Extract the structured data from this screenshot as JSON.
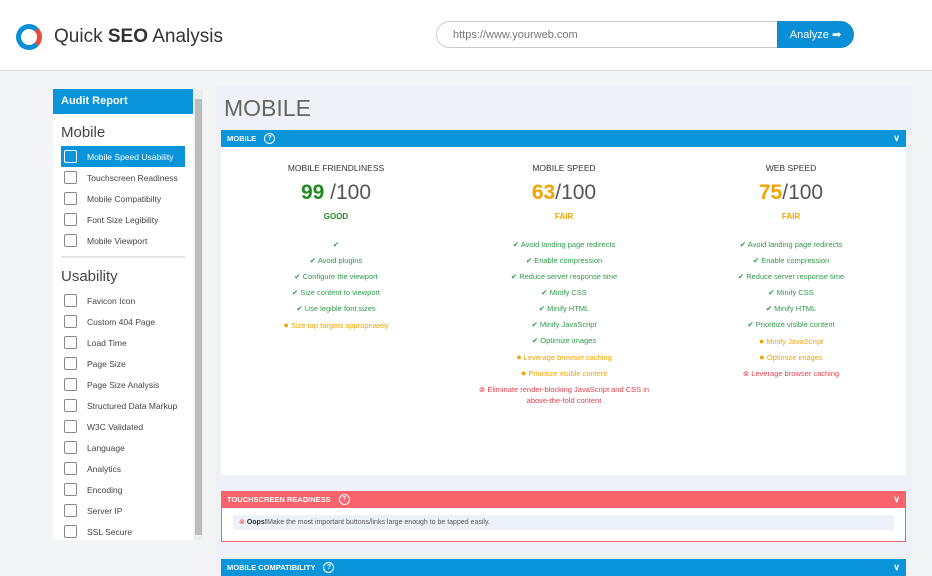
{
  "header": {
    "brand_prefix": "Quick",
    "brand_bold": "SEO",
    "brand_suffix": "Analysis",
    "search_placeholder": "https://www.yourweb.com",
    "analyze_label": "Analyze ➡"
  },
  "sidebar": {
    "title": "Audit Report",
    "sections": [
      {
        "title": "Mobile",
        "items": [
          "Mobile Speed Usability",
          "Touchscreen Readiness",
          "Mobile Compatibilty",
          "Font Size Legibility",
          "Mobile Viewport"
        ]
      },
      {
        "title": "Usability",
        "items": [
          "Favicon Icon",
          "Custom 404 Page",
          "Load Time",
          "Page Size",
          "Page Size Analysis",
          "Structured Data Markup",
          "W3C Validated",
          "Language",
          "Analytics",
          "Encoding",
          "Server IP",
          "SSL Secure"
        ]
      }
    ],
    "active": "Mobile Speed Usability"
  },
  "main": {
    "title": "MOBILE",
    "mobile_section": {
      "label": "MOBILE",
      "columns": [
        {
          "title": "MOBILE FRIENDLINESS",
          "score": "99",
          "max": " /100",
          "rating": "GOOD",
          "color": "#1f8a1f",
          "items": [
            {
              "s": "ok",
              "t": ""
            },
            {
              "s": "ok",
              "t": "Avoid plugins"
            },
            {
              "s": "ok",
              "t": "Configure the viewport"
            },
            {
              "s": "ok",
              "t": "Size content to viewport"
            },
            {
              "s": "ok",
              "t": "Use legible font sizes"
            },
            {
              "s": "warn",
              "t": "Size tap targets appropriately"
            }
          ]
        },
        {
          "title": "MOBILE SPEED",
          "score": "63",
          "max": "/100",
          "rating": "FAIR",
          "color": "#f5a300",
          "items": [
            {
              "s": "ok",
              "t": "Avoid landing page redirects"
            },
            {
              "s": "ok",
              "t": "Enable compression"
            },
            {
              "s": "ok",
              "t": "Reduce server response time"
            },
            {
              "s": "ok",
              "t": "Minify CSS"
            },
            {
              "s": "ok",
              "t": "Minify HTML"
            },
            {
              "s": "ok",
              "t": "Minify JavaScript"
            },
            {
              "s": "ok",
              "t": "Optimize images"
            },
            {
              "s": "warn",
              "t": "Leverage browser caching"
            },
            {
              "s": "warn",
              "t": "Prioritize visible content"
            },
            {
              "s": "err",
              "t": "Eliminate render-blocking JavaScript and CSS in above-the-fold content"
            }
          ]
        },
        {
          "title": "WEB SPEED",
          "score": "75",
          "max": "/100",
          "rating": "FAIR",
          "color": "#f5a300",
          "items": [
            {
              "s": "ok",
              "t": "Avoid landing page redirects"
            },
            {
              "s": "ok",
              "t": "Enable compression"
            },
            {
              "s": "ok",
              "t": "Reduce server response time"
            },
            {
              "s": "ok",
              "t": "Minify CSS"
            },
            {
              "s": "ok",
              "t": "Minify HTML"
            },
            {
              "s": "ok",
              "t": "Prioritize visible content"
            },
            {
              "s": "warn",
              "t": "Minify JavaScript"
            },
            {
              "s": "warn",
              "t": "Optimize images"
            },
            {
              "s": "err",
              "t": "Leverage browser caching"
            }
          ]
        }
      ]
    },
    "touch_section": {
      "label": "TOUCHSCREEN READINESS",
      "oops": "Oops!",
      "message": "Make the most important buttons/links large enough to be tapped easily."
    },
    "compat_section": {
      "label": "MOBILE COMPATIBILITY"
    }
  }
}
